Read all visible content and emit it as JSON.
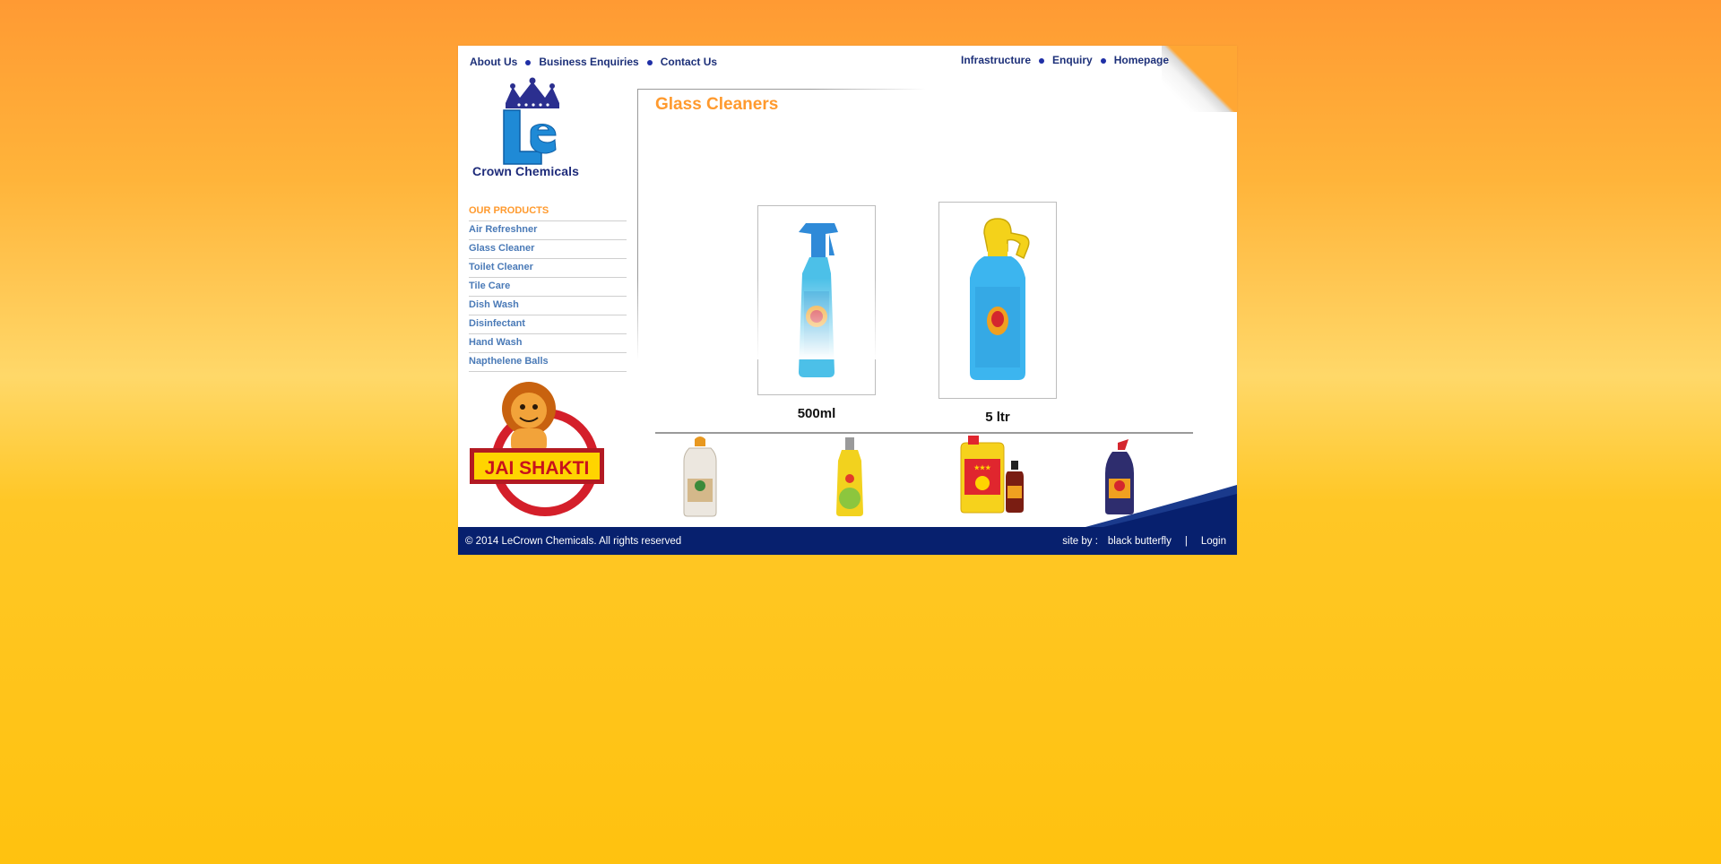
{
  "nav_left": [
    "About Us",
    "Business Enquiries",
    "Contact Us"
  ],
  "nav_right": [
    "Infrastructure",
    "Enquiry",
    "Homepage"
  ],
  "logo": {
    "mark": "Le",
    "text": "Crown Chemicals"
  },
  "sidebar": {
    "heading": "OUR PRODUCTS",
    "items": [
      "Air Refreshner",
      "Glass Cleaner",
      "Toilet Cleaner",
      "Tile Care",
      "Dish Wash",
      "Disinfectant",
      "Hand Wash",
      "Napthelene Balls"
    ]
  },
  "promo": {
    "brand": "JAI SHAKTI"
  },
  "main": {
    "title": "Glass Cleaners",
    "products": [
      {
        "label": "500ml"
      },
      {
        "label": "5 ltr"
      }
    ]
  },
  "footer": {
    "copyright": "© 2014 LeCrown Chemicals. All rights reserved",
    "site_by_label": "site by :",
    "site_by_name": "black butterfly",
    "separator": "|",
    "login": "Login"
  },
  "colors": {
    "accent": "#ff9a2e",
    "nav_text": "#1d3079",
    "footer_bg": "#07206e",
    "link_blue": "#4a7ab7"
  }
}
